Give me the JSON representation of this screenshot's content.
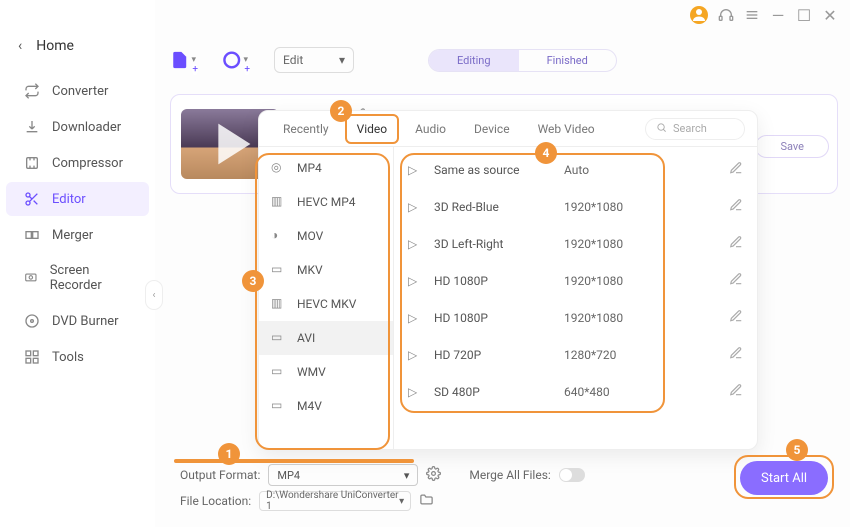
{
  "titlebar": {
    "min": "—",
    "max": "☐",
    "close": "✕"
  },
  "sidebar": {
    "back": "Home",
    "items": [
      {
        "label": "Converter"
      },
      {
        "label": "Downloader"
      },
      {
        "label": "Compressor"
      },
      {
        "label": "Editor"
      },
      {
        "label": "Merger"
      },
      {
        "label": "Screen Recorder"
      },
      {
        "label": "DVD Burner"
      },
      {
        "label": "Tools"
      }
    ]
  },
  "topbar": {
    "edit_label": "Edit",
    "seg_editing": "Editing",
    "seg_finished": "Finished"
  },
  "card": {
    "save": "Save"
  },
  "format_panel": {
    "tabs": [
      "Recently",
      "Video",
      "Audio",
      "Device",
      "Web Video"
    ],
    "search_placeholder": "Search",
    "formats": [
      "MP4",
      "HEVC MP4",
      "MOV",
      "MKV",
      "HEVC MKV",
      "AVI",
      "WMV",
      "M4V"
    ],
    "presets": [
      {
        "name": "Same as source",
        "res": "Auto"
      },
      {
        "name": "3D Red-Blue",
        "res": "1920*1080"
      },
      {
        "name": "3D Left-Right",
        "res": "1920*1080"
      },
      {
        "name": "HD 1080P",
        "res": "1920*1080"
      },
      {
        "name": "HD 1080P",
        "res": "1920*1080"
      },
      {
        "name": "HD 720P",
        "res": "1280*720"
      },
      {
        "name": "SD 480P",
        "res": "640*480"
      }
    ]
  },
  "bottom": {
    "output_format_label": "Output Format:",
    "output_format_value": "MP4",
    "merge_label": "Merge All Files:",
    "start_all": "Start All",
    "file_location_label": "File Location:",
    "file_location_value": "D:\\Wondershare UniConverter 1"
  },
  "badges": {
    "b1": "1",
    "b2": "2",
    "b3": "3",
    "b4": "4",
    "b5": "5"
  }
}
